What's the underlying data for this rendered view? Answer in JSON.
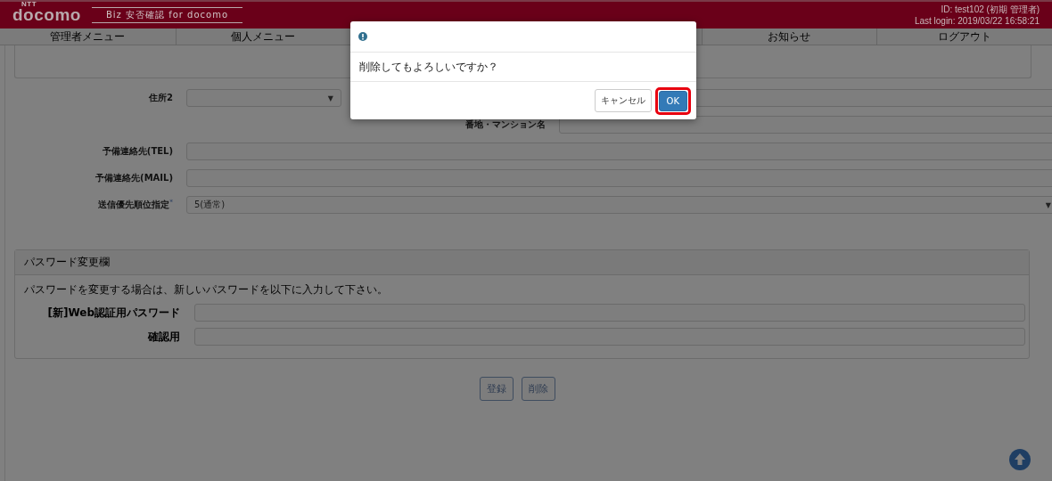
{
  "header": {
    "logo": "docomo",
    "logo_mark": "NTT",
    "service": "Biz 安否確認 for docomo",
    "user_id": "ID: test102 (初期 管理者)",
    "last_login": "Last login: 2019/03/22 16:58:21"
  },
  "tabs": [
    {
      "label": "管理者メニュー"
    },
    {
      "label": "個人メニュー"
    },
    {
      "label": "お知らせ"
    },
    {
      "label": "ログアウト"
    }
  ],
  "form": {
    "rows": [
      {
        "kind": "pair",
        "left": {
          "label": "住所2",
          "kind": "select",
          "caret": "▼"
        },
        "right": {
          "kind": "input"
        }
      },
      {
        "kind": "pair",
        "right": {
          "label": "番地・マンション名",
          "kind": "input"
        }
      },
      {
        "kind": "full",
        "label": "予備連絡先(TEL)",
        "field": {
          "kind": "input"
        }
      },
      {
        "kind": "full",
        "label": "予備連絡先(MAIL)",
        "field": {
          "kind": "input"
        }
      },
      {
        "kind": "full",
        "label": "送信優先順位指定",
        "required_mark": "*",
        "field": {
          "kind": "select",
          "value": "5(通常)",
          "caret": "▼"
        }
      }
    ]
  },
  "password_panel": {
    "title": "パスワード変更欄",
    "note": "パスワードを変更する場合は、新しいパスワードを以下に入力して下さい。",
    "rows": [
      {
        "label": "[新]Web認証用パスワード"
      },
      {
        "label": "確認用"
      }
    ]
  },
  "buttons": [
    "登録",
    "削除"
  ],
  "dialog": {
    "message": "削除してもよろしいですか？",
    "buttons": [
      {
        "label": "キャンセル",
        "kind": "default",
        "highlighted": false
      },
      {
        "label": "OK",
        "kind": "primary",
        "highlighted": true
      }
    ]
  }
}
